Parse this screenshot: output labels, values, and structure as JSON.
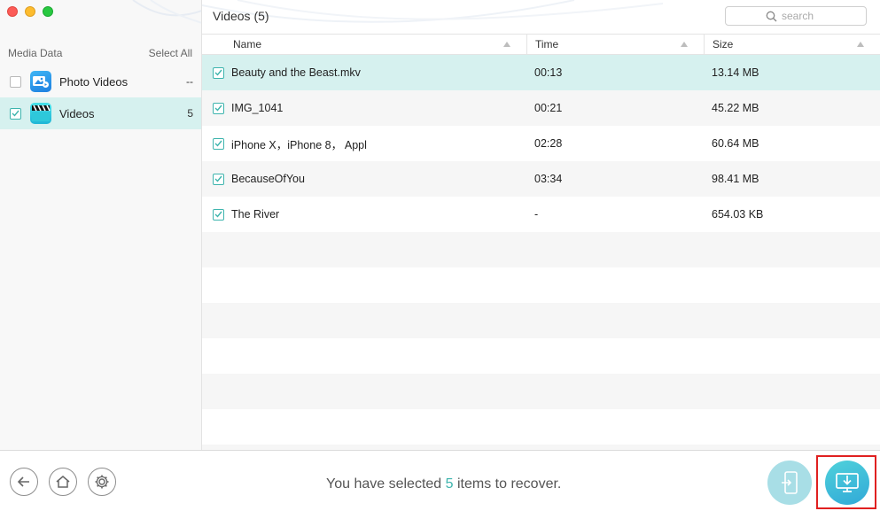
{
  "window": {
    "controls": [
      "close",
      "minimize",
      "maximize"
    ]
  },
  "sidebar": {
    "header_label": "Media Data",
    "select_all_label": "Select All",
    "items": [
      {
        "label": "Photo Videos",
        "count": "--",
        "checked": false,
        "icon": "photo-videos-icon",
        "selected": false
      },
      {
        "label": "Videos",
        "count": "5",
        "checked": true,
        "icon": "videos-clapperboard-icon",
        "selected": true
      }
    ]
  },
  "main": {
    "title": "Videos (5)",
    "search": {
      "placeholder": "search",
      "value": ""
    },
    "columns": [
      {
        "label": "Name"
      },
      {
        "label": "Time"
      },
      {
        "label": "Size"
      }
    ],
    "rows": [
      {
        "name": "Beauty and the Beast.mkv",
        "time": "00:13",
        "size": "13.14 MB",
        "checked": true
      },
      {
        "name": "IMG_1041",
        "time": "00:21",
        "size": "45.22 MB",
        "checked": true
      },
      {
        "name": "iPhone X，iPhone 8， Appl",
        "time": "02:28",
        "size": "60.64 MB",
        "checked": true
      },
      {
        "name": "BecauseOfYou",
        "time": "03:34",
        "size": "98.41 MB",
        "checked": true
      },
      {
        "name": "The River",
        "time": "-",
        "size": "654.03 KB",
        "checked": true
      }
    ]
  },
  "footer": {
    "status_prefix": "You have selected ",
    "selected_count": "5",
    "status_suffix": " items to recover.",
    "buttons": [
      "back-icon",
      "home-icon",
      "settings-gear-icon",
      "recover-to-device-icon",
      "recover-to-computer-icon"
    ]
  },
  "colors": {
    "accent": "#3db4ad",
    "selected_row": "#d6f1ef",
    "highlight": "#e02020"
  }
}
